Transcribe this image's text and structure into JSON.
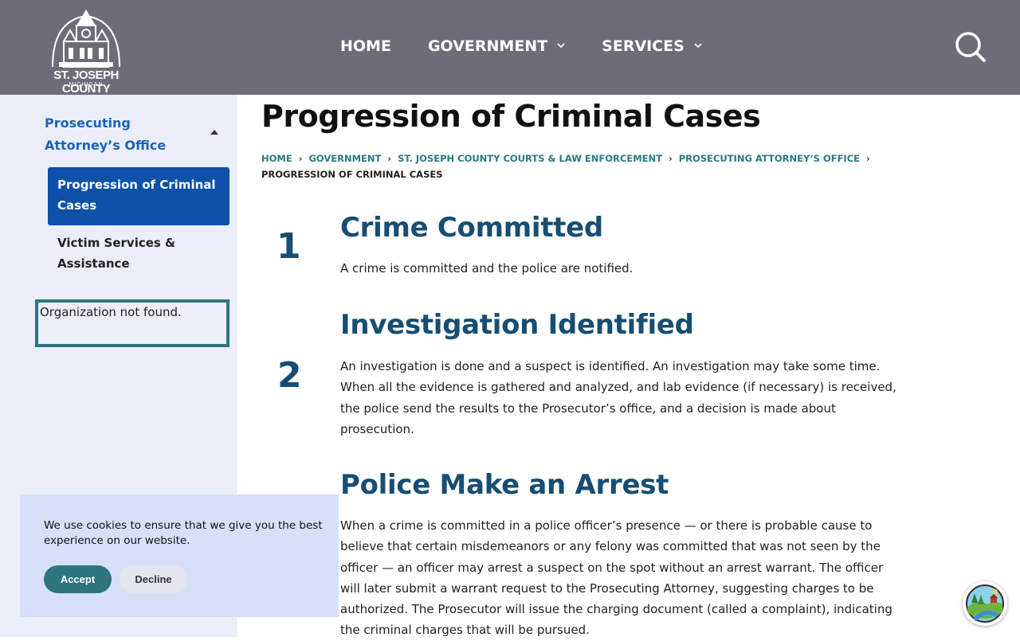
{
  "header": {
    "logo_text": "ST. JOSEPH COUNTY",
    "logo_sub": "MICHIGAN",
    "nav": [
      {
        "label": "HOME"
      },
      {
        "label": "GOVERNMENT"
      },
      {
        "label": "SERVICES"
      }
    ],
    "search_icon": "search-icon"
  },
  "sidebar": {
    "parent_label": "Prosecuting Attorney’s Office",
    "items": [
      {
        "label": "Progression of Criminal Cases",
        "active": true
      },
      {
        "label": "Victim Services & Assistance",
        "active": false
      }
    ],
    "org_message": "Organization not found."
  },
  "page": {
    "title": "Progression of Criminal Cases",
    "breadcrumb": [
      "HOME",
      "GOVERNMENT",
      "ST. JOSEPH COUNTY COURTS & LAW ENFORCEMENT",
      "PROSECUTING ATTORNEY’S OFFICE"
    ],
    "breadcrumb_current": "PROGRESSION OF CRIMINAL CASES",
    "steps": [
      {
        "number": "1",
        "title": "Crime Committed",
        "body": "A crime is committed and the police are notified."
      },
      {
        "number": "2",
        "title": "Investigation Identified",
        "body": "An investigation is done and a suspect is identified. An investigation may take some time. When all the evidence is gathered and analyzed, and lab evidence (if necessary) is received, the police send the results to the Prosecutor’s office, and a decision is made about prosecution."
      },
      {
        "number": "",
        "title": "Police Make an Arrest",
        "body": "When a crime is committed in a police officer’s presence — or there is probable cause to believe that certain misdemeanors or any felony was committed that was not seen by the officer — an officer may arrest a suspect on the spot without an arrest warrant. The officer will later submit a warrant request to the Prosecuting Attorney, suggesting charges to be authorized. The Prosecutor will issue the charging document (called a complaint), indicating the criminal charges that will be pursued."
      }
    ]
  },
  "cookie": {
    "text": "We use cookies to ensure that we give you the best experience on our website.",
    "accept_label": "Accept",
    "decline_label": "Decline"
  },
  "colors": {
    "header_bg": "#6e6d77",
    "sidebar_bg": "#ebeef9",
    "active_item_bg": "#0d51a8",
    "link": "#1a64b7",
    "heading": "#174e73",
    "teal": "#2f7580",
    "cookie_bg": "#d8e0f8"
  }
}
